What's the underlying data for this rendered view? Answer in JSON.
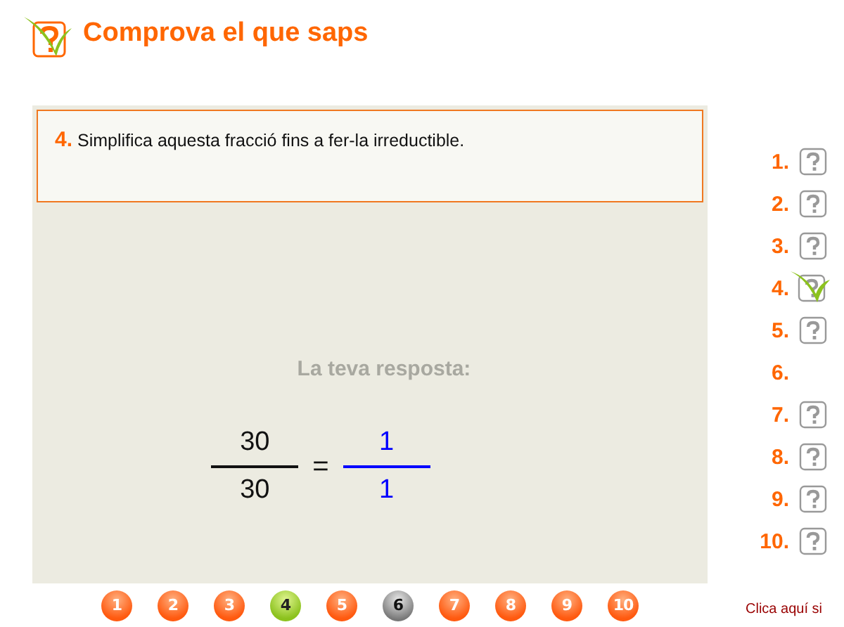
{
  "header": {
    "title": "Comprova el que saps"
  },
  "question": {
    "number": "4.",
    "text": "Simplifica aquesta fracció fins a fer-la irreductible."
  },
  "answer": {
    "label": "La teva resposta:",
    "given": {
      "numerator": "30",
      "denominator": "30"
    },
    "operator": "=",
    "result": {
      "numerator": "1",
      "denominator": "1"
    }
  },
  "question_list": [
    {
      "label": "1.",
      "kind": "pending"
    },
    {
      "label": "2.",
      "kind": "pending"
    },
    {
      "label": "3.",
      "kind": "pending"
    },
    {
      "label": "4.",
      "kind": "correct"
    },
    {
      "label": "5.",
      "kind": "pending"
    },
    {
      "label": "6.",
      "kind": "none"
    },
    {
      "label": "7.",
      "kind": "pending"
    },
    {
      "label": "8.",
      "kind": "pending"
    },
    {
      "label": "9.",
      "kind": "pending"
    },
    {
      "label": "10.",
      "kind": "pending"
    }
  ],
  "pager": [
    {
      "label": "1",
      "kind": "pending"
    },
    {
      "label": "2",
      "kind": "pending"
    },
    {
      "label": "3",
      "kind": "pending"
    },
    {
      "label": "4",
      "kind": "correct"
    },
    {
      "label": "5",
      "kind": "pending"
    },
    {
      "label": "6",
      "kind": "blank"
    },
    {
      "label": "7",
      "kind": "pending"
    },
    {
      "label": "8",
      "kind": "pending"
    },
    {
      "label": "9",
      "kind": "pending"
    },
    {
      "label": "10",
      "kind": "pending"
    }
  ],
  "footer_link": "Clica aquí si"
}
